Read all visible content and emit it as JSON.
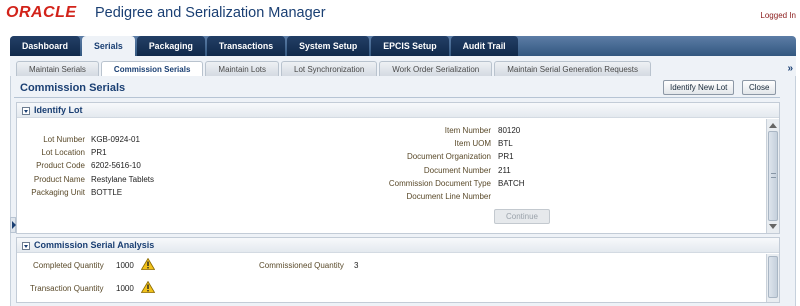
{
  "branding": {
    "oracle_logo": "ORACLE",
    "app_title": "Pedigree and Serialization Manager",
    "logged_in": "Logged In"
  },
  "main_tabs": [
    "Dashboard",
    "Serials",
    "Packaging",
    "Transactions",
    "System Setup",
    "EPCIS Setup",
    "Audit Trail"
  ],
  "sub_tabs": [
    "Maintain Serials",
    "Commission Serials",
    "Maintain Lots",
    "Lot Synchronization",
    "Work Order Serialization",
    "Maintain Serial Generation Requests"
  ],
  "sub_tabs_more": "»",
  "page": {
    "title": "Commission Serials",
    "identify_button": "Identify New Lot",
    "close_button": "Close"
  },
  "identify_lot": {
    "title": "Identify Lot",
    "left_fields": [
      {
        "label": "Lot Number",
        "value": "KGB-0924-01"
      },
      {
        "label": "Lot Location",
        "value": "PR1"
      },
      {
        "label": "Product Code",
        "value": "6202-5616-10"
      },
      {
        "label": "Product Name",
        "value": "Restylane Tablets"
      },
      {
        "label": "Packaging Unit",
        "value": "BOTTLE"
      }
    ],
    "right_fields": [
      {
        "label": "Item Number",
        "value": "80120"
      },
      {
        "label": "Item UOM",
        "value": "BTL"
      },
      {
        "label": "Document Organization",
        "value": "PR1"
      },
      {
        "label": "Document Number",
        "value": "211"
      },
      {
        "label": "Commission Document Type",
        "value": "BATCH"
      },
      {
        "label": "Document Line Number",
        "value": ""
      }
    ],
    "continue_button": "Continue"
  },
  "analysis": {
    "title": "Commission Serial Analysis",
    "completed_label": "Completed Quantity",
    "completed_value": "1000",
    "commissioned_label": "Commissioned Quantity",
    "commissioned_value": "3",
    "transaction_label": "Transaction Quantity",
    "transaction_value": "1000"
  },
  "colors": {
    "brand_red": "#d2231a",
    "nav_blue": "#1a3f73",
    "warning_yellow": "#f2c21b"
  }
}
